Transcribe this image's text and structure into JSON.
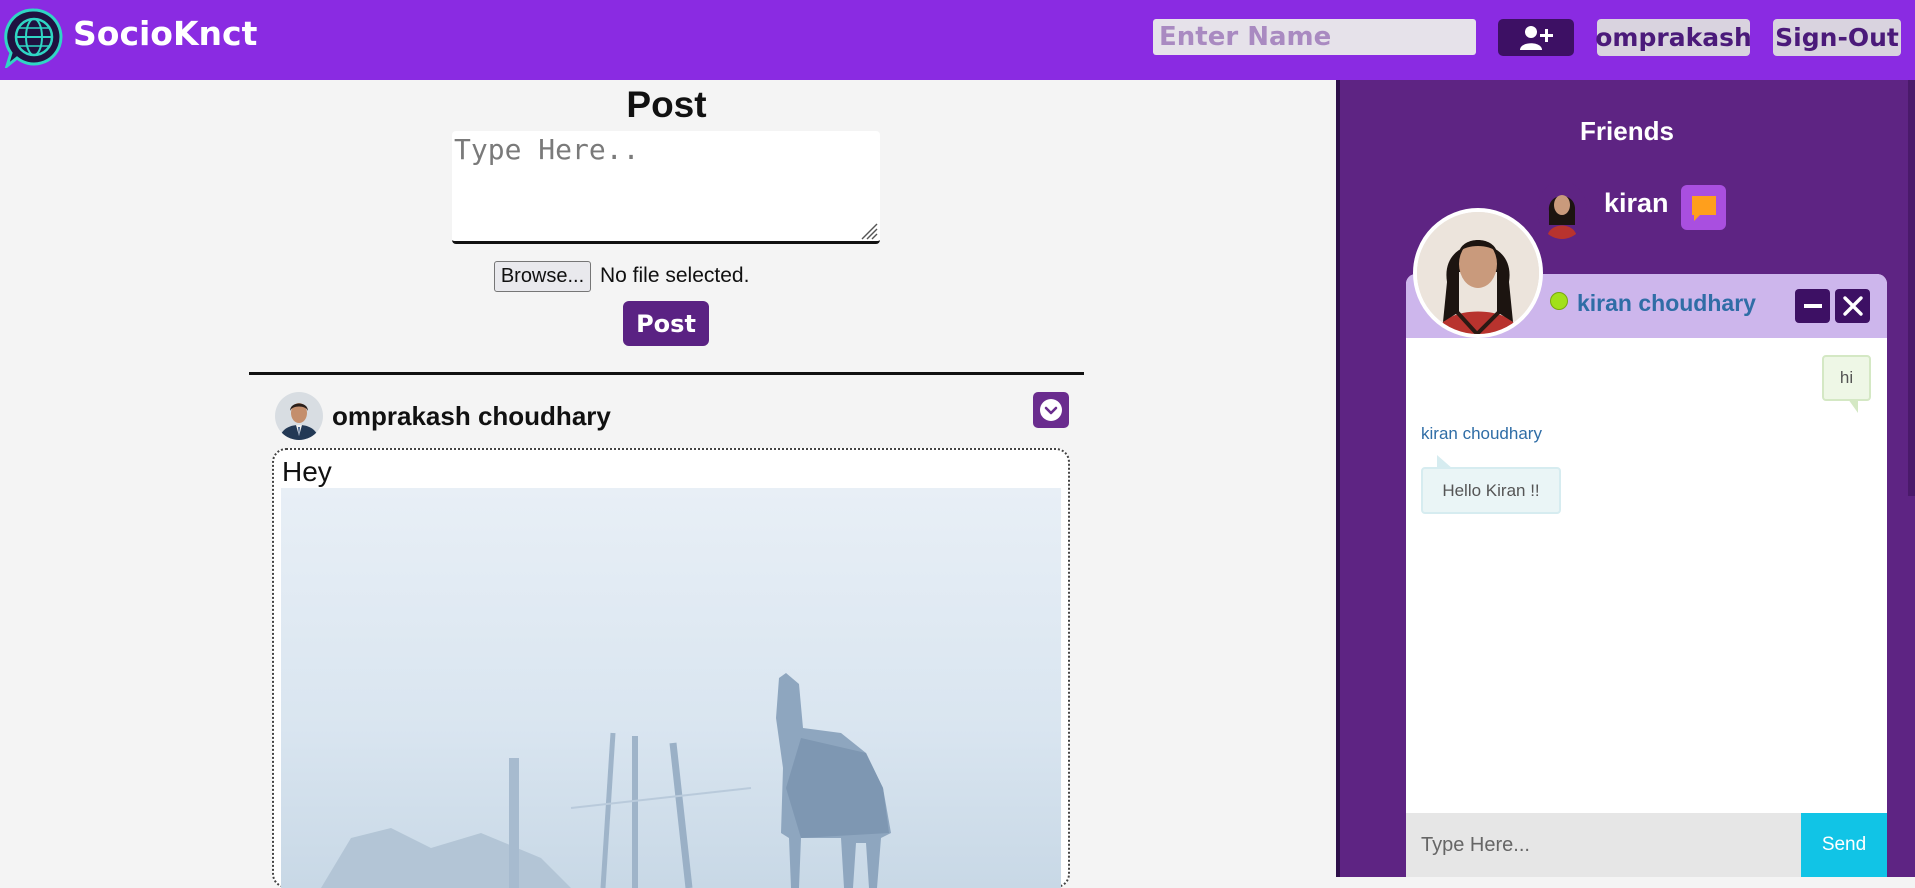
{
  "header": {
    "brand": "SocioKnct",
    "search_placeholder": "Enter Name",
    "username": "omprakash",
    "signout_label": "Sign-Out",
    "accent_color": "#8a2be2"
  },
  "composer": {
    "title": "Post",
    "placeholder": "Type Here..",
    "browse_label": "Browse...",
    "file_status": "No file selected.",
    "submit_label": "Post"
  },
  "feed": {
    "posts": [
      {
        "author": "omprakash choudhary",
        "text": "Hey",
        "has_image": true
      }
    ]
  },
  "sidebar": {
    "title": "Friends",
    "friends": [
      {
        "name": "kiran"
      }
    ]
  },
  "chat": {
    "title": "kiran choudhary",
    "status": "online",
    "messages": [
      {
        "direction": "out",
        "text": "hi"
      },
      {
        "direction": "in",
        "sender": "kiran choudhary",
        "text": "Hello Kiran !!"
      }
    ],
    "input_placeholder": "Type Here...",
    "send_label": "Send"
  }
}
